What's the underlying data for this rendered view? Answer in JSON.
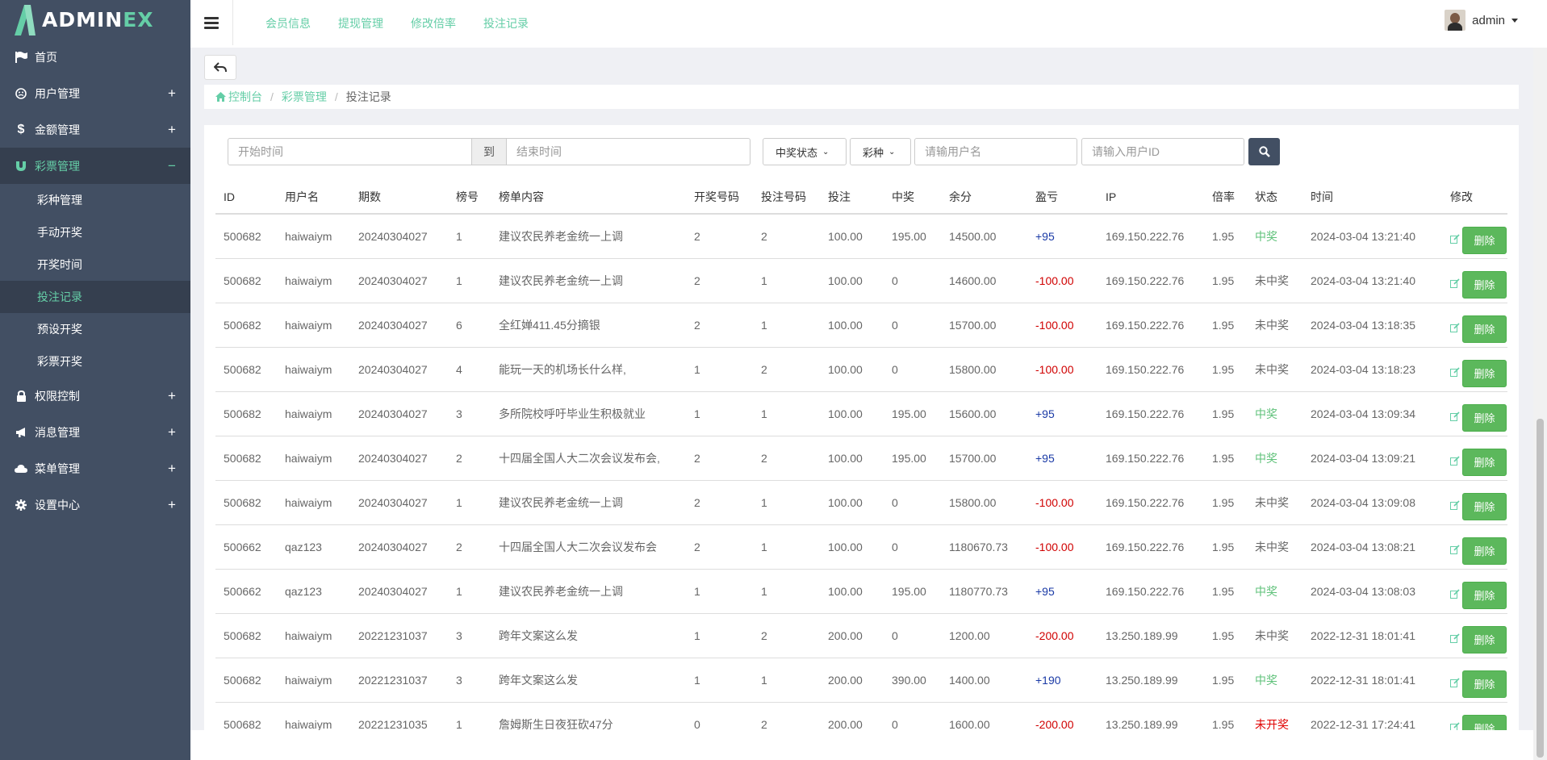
{
  "brand": {
    "name_a": "ADMIN",
    "name_b": "EX"
  },
  "sidebar": {
    "items": [
      {
        "label": "首页",
        "icon": "flag-icon"
      },
      {
        "label": "用户管理",
        "icon": "smile-icon",
        "toggle": "+"
      },
      {
        "label": "金额管理",
        "icon": "dollar-icon",
        "toggle": "+"
      },
      {
        "label": "彩票管理",
        "icon": "magnet-icon",
        "toggle": "−",
        "active": true
      },
      {
        "label": "权限控制",
        "icon": "lock-icon",
        "toggle": "+"
      },
      {
        "label": "消息管理",
        "icon": "bullhorn-icon",
        "toggle": "+"
      },
      {
        "label": "菜单管理",
        "icon": "cloud-icon",
        "toggle": "+"
      },
      {
        "label": "设置中心",
        "icon": "gear-icon",
        "toggle": "+"
      }
    ],
    "sub_items": [
      "彩种管理",
      "手动开奖",
      "开奖时间",
      "投注记录",
      "预设开奖",
      "彩票开奖"
    ]
  },
  "header": {
    "links": [
      "会员信息",
      "提现管理",
      "修改倍率",
      "投注记录"
    ],
    "user": "admin"
  },
  "breadcrumb": {
    "home": "控制台",
    "section": "彩票管理",
    "current": "投注记录"
  },
  "filters": {
    "start_placeholder": "开始时间",
    "to": "到",
    "end_placeholder": "结束时间",
    "win_status": "中奖状态",
    "lottery": "彩种",
    "username_placeholder": "请输用户名",
    "userid_placeholder": "请输入用户ID"
  },
  "colors": {
    "accent": "#65cea7",
    "sidebar": "#424f63",
    "delete": "#5cb85c",
    "profit": "#1a3aa6",
    "loss": "#d00000"
  },
  "table": {
    "headers": [
      "ID",
      "用户名",
      "期数",
      "榜号",
      "榜单内容",
      "开奖号码",
      "投注号码",
      "投注",
      "中奖",
      "余分",
      "盈亏",
      "IP",
      "倍率",
      "状态",
      "时间",
      "修改"
    ],
    "delete_label": "删除",
    "rows": [
      [
        "500682",
        "haiwaiym",
        "20240304027",
        "1",
        "建议农民养老金统一上调",
        "2",
        "2",
        "100.00",
        "195.00",
        "14500.00",
        "+95",
        "169.150.222.76",
        "1.95",
        "中奖",
        "2024-03-04 13:21:40"
      ],
      [
        "500682",
        "haiwaiym",
        "20240304027",
        "1",
        "建议农民养老金统一上调",
        "2",
        "1",
        "100.00",
        "0",
        "14600.00",
        "-100.00",
        "169.150.222.76",
        "1.95",
        "未中奖",
        "2024-03-04 13:21:40"
      ],
      [
        "500682",
        "haiwaiym",
        "20240304027",
        "6",
        "全红婵411.45分摘银",
        "2",
        "1",
        "100.00",
        "0",
        "15700.00",
        "-100.00",
        "169.150.222.76",
        "1.95",
        "未中奖",
        "2024-03-04 13:18:35"
      ],
      [
        "500682",
        "haiwaiym",
        "20240304027",
        "4",
        "能玩一天的机场长什么样,",
        "1",
        "2",
        "100.00",
        "0",
        "15800.00",
        "-100.00",
        "169.150.222.76",
        "1.95",
        "未中奖",
        "2024-03-04 13:18:23"
      ],
      [
        "500682",
        "haiwaiym",
        "20240304027",
        "3",
        "多所院校呼吁毕业生积极就业",
        "1",
        "1",
        "100.00",
        "195.00",
        "15600.00",
        "+95",
        "169.150.222.76",
        "1.95",
        "中奖",
        "2024-03-04 13:09:34"
      ],
      [
        "500682",
        "haiwaiym",
        "20240304027",
        "2",
        "十四届全国人大二次会议发布会,",
        "2",
        "2",
        "100.00",
        "195.00",
        "15700.00",
        "+95",
        "169.150.222.76",
        "1.95",
        "中奖",
        "2024-03-04 13:09:21"
      ],
      [
        "500682",
        "haiwaiym",
        "20240304027",
        "1",
        "建议农民养老金统一上调",
        "2",
        "1",
        "100.00",
        "0",
        "15800.00",
        "-100.00",
        "169.150.222.76",
        "1.95",
        "未中奖",
        "2024-03-04 13:09:08"
      ],
      [
        "500662",
        "qaz123",
        "20240304027",
        "2",
        "十四届全国人大二次会议发布会",
        "2",
        "1",
        "100.00",
        "0",
        "1180670.73",
        "-100.00",
        "169.150.222.76",
        "1.95",
        "未中奖",
        "2024-03-04 13:08:21"
      ],
      [
        "500662",
        "qaz123",
        "20240304027",
        "1",
        "建议农民养老金统一上调",
        "1",
        "1",
        "100.00",
        "195.00",
        "1180770.73",
        "+95",
        "169.150.222.76",
        "1.95",
        "中奖",
        "2024-03-04 13:08:03"
      ],
      [
        "500682",
        "haiwaiym",
        "20221231037",
        "3",
        "跨年文案这么发",
        "1",
        "2",
        "200.00",
        "0",
        "1200.00",
        "-200.00",
        "13.250.189.99",
        "1.95",
        "未中奖",
        "2022-12-31 18:01:41"
      ],
      [
        "500682",
        "haiwaiym",
        "20221231037",
        "3",
        "跨年文案这么发",
        "1",
        "1",
        "200.00",
        "390.00",
        "1400.00",
        "+190",
        "13.250.189.99",
        "1.95",
        "中奖",
        "2022-12-31 18:01:41"
      ],
      [
        "500682",
        "haiwaiym",
        "20221231035",
        "1",
        "詹姆斯生日夜狂砍47分",
        "0",
        "2",
        "200.00",
        "0",
        "1600.00",
        "-200.00",
        "13.250.189.99",
        "1.95",
        "未开奖",
        "2022-12-31 17:24:41"
      ]
    ]
  }
}
